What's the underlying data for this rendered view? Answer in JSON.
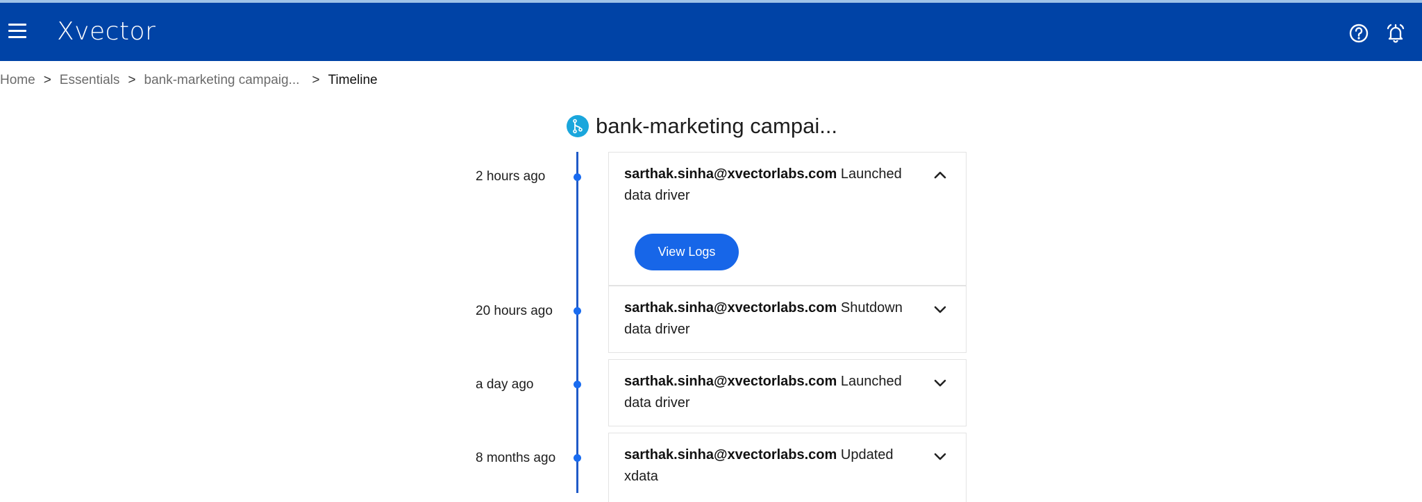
{
  "header": {
    "logo": "Xvector",
    "icons": [
      "menu-icon",
      "help-icon",
      "notification-bell-icon"
    ]
  },
  "breadcrumb": {
    "items": [
      "Home",
      "Essentials",
      "bank-marketing campaig...",
      "Timeline"
    ],
    "separator": ">"
  },
  "page": {
    "title": "bank-marketing campai...",
    "icon": "branch-icon"
  },
  "timeline": [
    {
      "time": "2 hours ago",
      "user": "sarthak.sinha@xvectorlabs.com",
      "action": "Launched",
      "rest": "data driver",
      "expanded": true,
      "button": "View Logs"
    },
    {
      "time": "20 hours ago",
      "user": "sarthak.sinha@xvectorlabs.com",
      "action": "Shutdown",
      "rest": "data driver",
      "expanded": false
    },
    {
      "time": "a day ago",
      "user": "sarthak.sinha@xvectorlabs.com",
      "action": "Launched",
      "rest": "data driver",
      "expanded": false
    },
    {
      "time": "8 months ago",
      "user": "sarthak.sinha@xvectorlabs.com",
      "action": "Updated",
      "rest": "xdata",
      "expanded": false
    }
  ],
  "colors": {
    "appbar": "#0043a6",
    "accent": "#1766e8",
    "timeline_line": "#1f5ac8",
    "project_icon": "#1aa6dc"
  }
}
